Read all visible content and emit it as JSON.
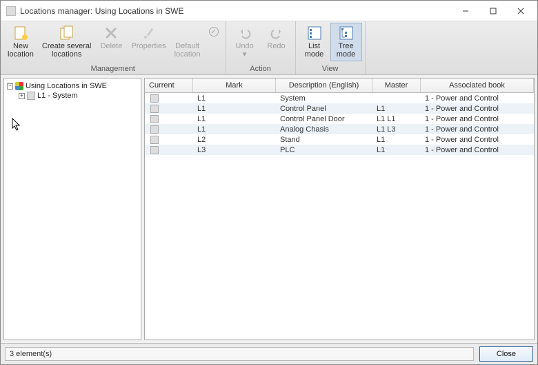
{
  "window": {
    "title": "Locations manager: Using Locations in SWE"
  },
  "ribbon": {
    "groups": {
      "management": {
        "label": "Management",
        "buttons": {
          "new": "New\nlocation",
          "create_several": "Create several\nlocations",
          "delete": "Delete",
          "properties": "Properties",
          "default": "Default\nlocation"
        }
      },
      "action": {
        "label": "Action",
        "buttons": {
          "undo": "Undo\n▾",
          "redo": "Redo"
        }
      },
      "view": {
        "label": "View",
        "buttons": {
          "list": "List\nmode",
          "tree": "Tree\nmode"
        }
      }
    }
  },
  "tree": {
    "root": {
      "label": "Using Locations in SWE"
    },
    "child": {
      "label": "L1 - System"
    }
  },
  "table": {
    "headers": {
      "current": "Current",
      "mark": "Mark",
      "desc": "Description (English)",
      "master": "Master",
      "book": "Associated book"
    },
    "rows": [
      {
        "mark": "L1",
        "desc": "System",
        "master": "",
        "book": "1 - Power and Control"
      },
      {
        "mark": "L1",
        "desc": "Control Panel",
        "master": "L1",
        "book": "1 - Power and Control"
      },
      {
        "mark": "L1",
        "desc": "Control Panel Door",
        "master": "L1 L1",
        "book": "1 - Power and Control"
      },
      {
        "mark": "L1",
        "desc": "Analog Chasis",
        "master": "L1 L3",
        "book": "1 - Power and Control"
      },
      {
        "mark": "L2",
        "desc": "Stand",
        "master": "L1",
        "book": "1 - Power and Control"
      },
      {
        "mark": "L3",
        "desc": "PLC",
        "master": "L1",
        "book": "1 - Power and Control"
      }
    ]
  },
  "status": "3 element(s)",
  "close": "Close"
}
